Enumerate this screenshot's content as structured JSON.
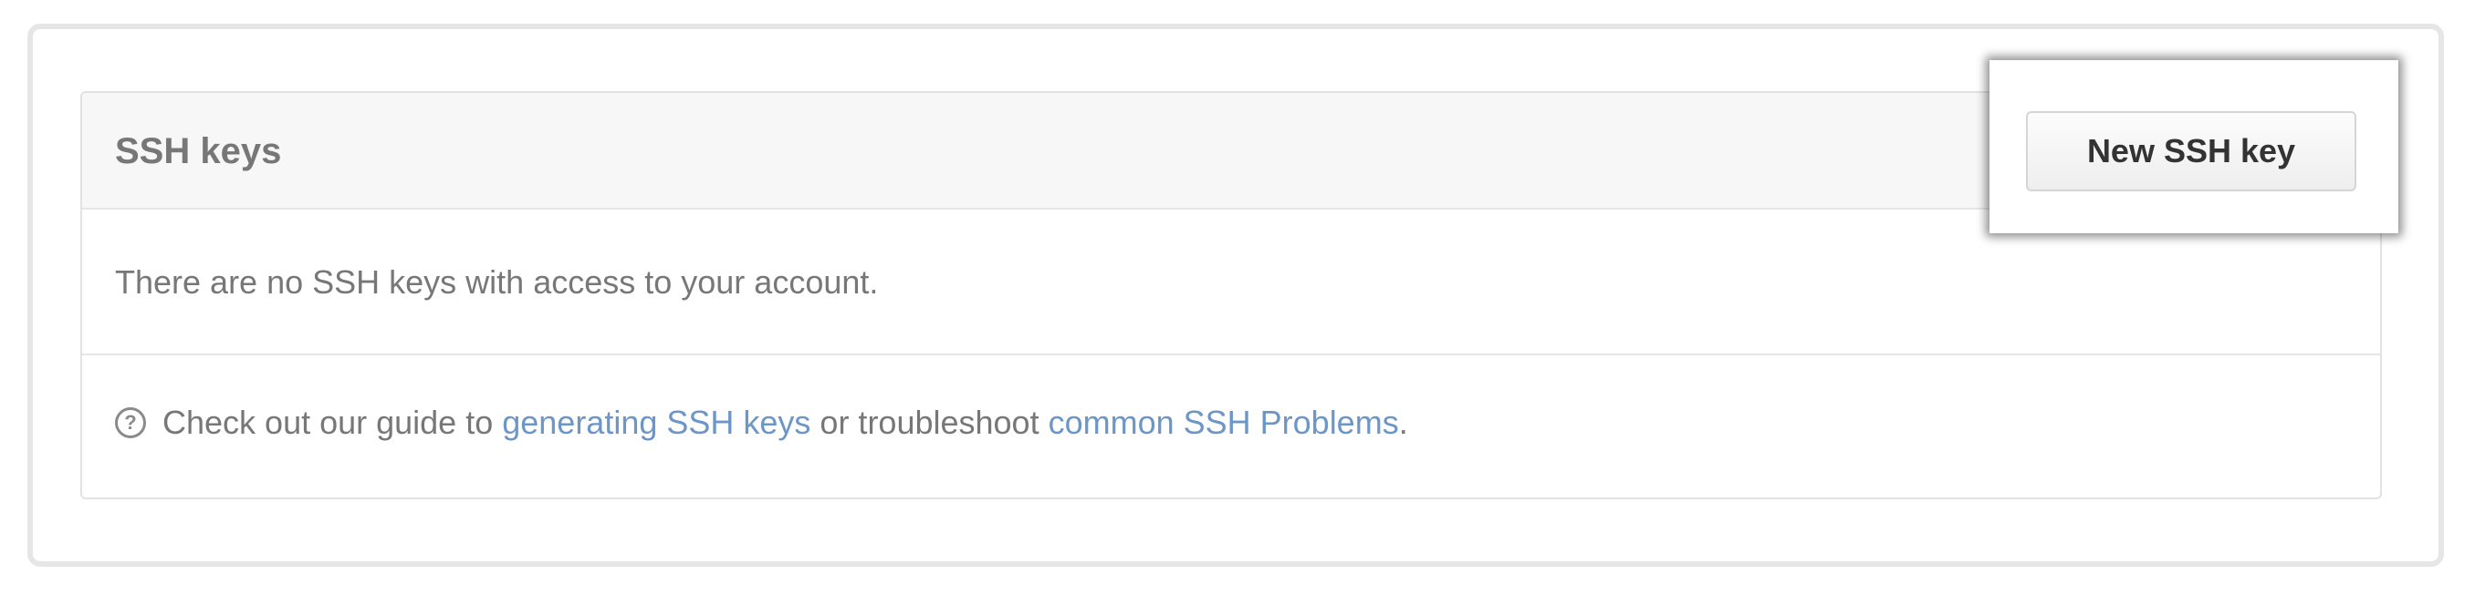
{
  "panel": {
    "title": "SSH keys",
    "new_button_label": "New SSH key",
    "empty_message": "There are no SSH keys with access to your account."
  },
  "help": {
    "icon": "question-circle-icon",
    "prefix": "Check out our guide to ",
    "link1": "generating SSH keys",
    "middle": " or troubleshoot ",
    "link2": "common SSH Problems",
    "suffix": "."
  },
  "colors": {
    "link": "#6d96c8",
    "muted_text": "#777777",
    "header_bg": "#f7f7f7",
    "border": "#e2e2e2"
  }
}
